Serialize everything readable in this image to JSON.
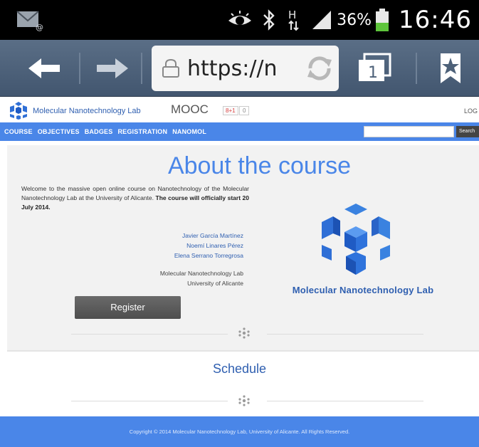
{
  "status_bar": {
    "battery_percent": "36%",
    "time": "16:46",
    "signal_type": "H",
    "icons": [
      "email-notification-icon",
      "eye-icon",
      "bluetooth-icon",
      "h-data-icon",
      "signal-icon",
      "battery-icon"
    ]
  },
  "browser": {
    "url": "https://n",
    "tab_count": "1",
    "icons": [
      "back-arrow-icon",
      "forward-arrow-icon",
      "lock-icon",
      "reload-icon",
      "tabs-icon",
      "bookmark-star-icon"
    ]
  },
  "site": {
    "name": "Molecular Nanotechnology Lab",
    "section": "MOOC",
    "gplus_label": "8+1",
    "gplus_count": "0",
    "login_label": "LOG"
  },
  "nav": {
    "items": [
      "COURSE",
      "OBJECTIVES",
      "BADGES",
      "REGISTRATION",
      "NANOMOL"
    ],
    "search_button": "Search"
  },
  "about": {
    "title": "About the course",
    "intro": "Welcome to the massive open online course on Nanotechnology of the Molecular Nanotechnology Lab at the University of Alicante.",
    "start_note": "The course will officially start 20 July 2014.",
    "authors": [
      "Javier García Martínez",
      "Noemí Linares Pérez",
      "Elena Serrano Torregrosa"
    ],
    "institution": [
      "Molecular Nanotechnology Lab",
      "University of Alicante"
    ],
    "register_label": "Register",
    "lab_caption": "Molecular Nanotechnology Lab"
  },
  "schedule": {
    "title": "Schedule"
  },
  "footer": {
    "text": "Copyright © 2014 Molecular Nanotechnology Lab, University of Alicante. All Rights Reserved."
  },
  "colors": {
    "brand_blue": "#4a86e8",
    "link_blue": "#2f5fb0",
    "toolbar": "#4d6179",
    "register_button": "#555555"
  }
}
